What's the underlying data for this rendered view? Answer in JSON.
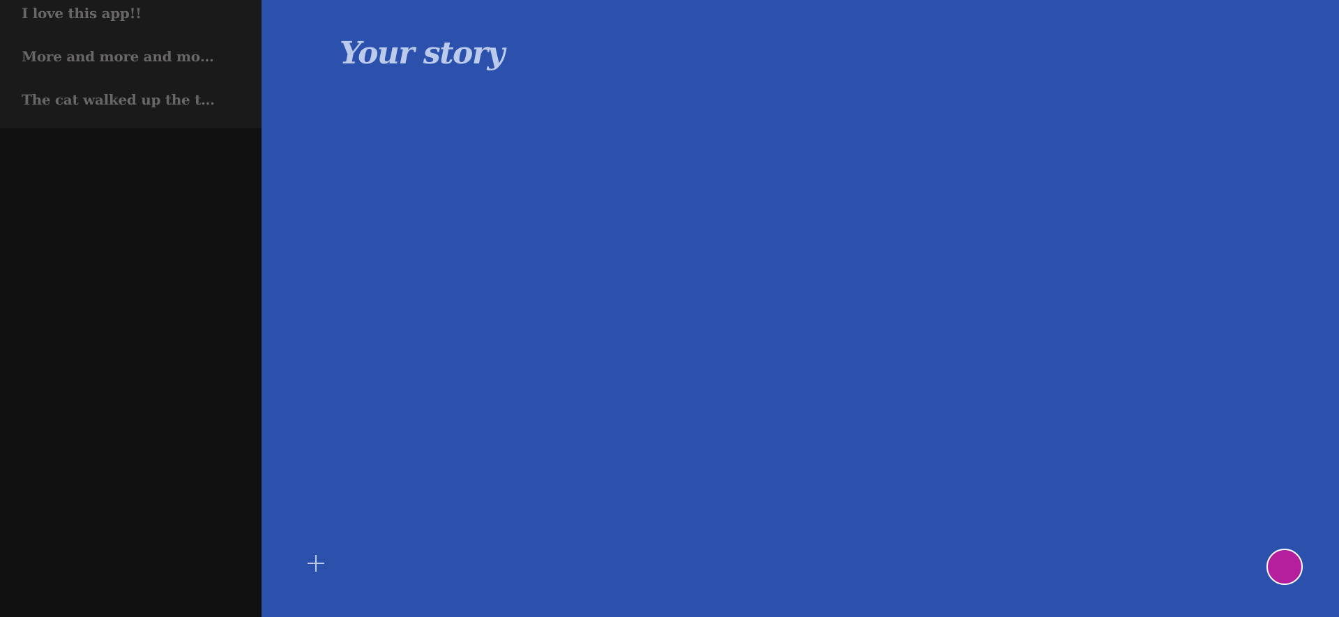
{
  "sidebar": {
    "stories": [
      {
        "title": "I love this app!!"
      },
      {
        "title": "More and more and more and..."
      },
      {
        "title": "The cat walked up the tree"
      }
    ]
  },
  "editor": {
    "title_placeholder": "Your story",
    "title_value": ""
  },
  "icons": {
    "add": "plus-icon",
    "fab": "circle-button"
  },
  "colors": {
    "sidebar_bg": "#121111",
    "story_list_bg": "#1b1a1a",
    "story_text": "#686666",
    "editor_bg": "#2b51ac",
    "title_text": "#bccbec",
    "fab_fill": "#b51f9e",
    "fab_border": "#ffffff"
  }
}
